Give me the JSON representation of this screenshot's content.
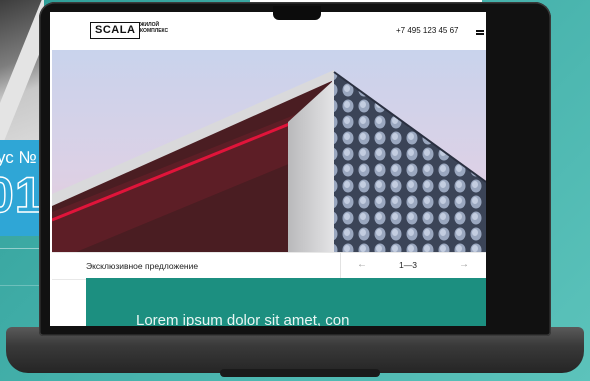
{
  "background": {
    "label_text": "ус №",
    "label_number": "01"
  },
  "site": {
    "logo": "SCALA",
    "logo_subtitle_line1": "ЖИЛОЙ",
    "logo_subtitle_line2": "КОМПЛЕКС",
    "phone": "+7 495 123 45 67",
    "menu_icon": "hamburger-icon"
  },
  "slider": {
    "caption": "Эксклюзивное предложение",
    "prev_icon": "arrow-left-icon",
    "next_icon": "arrow-right-icon",
    "prev_glyph": "←",
    "next_glyph": "→",
    "counter": "1—3"
  },
  "offer": {
    "text": "Lorem ipsum dolor sit amet, con"
  },
  "colors": {
    "background": "#3aa9a2",
    "offer_card": "#1c8f80",
    "accent_red": "#d4122f"
  }
}
